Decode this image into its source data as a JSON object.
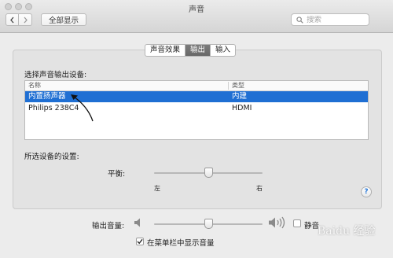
{
  "window": {
    "title": "声音"
  },
  "toolbar": {
    "back_icon": "chevron-left-icon",
    "forward_icon": "chevron-right-icon",
    "show_all_label": "全部显示",
    "search_placeholder": "搜索",
    "search_icon": "search-icon"
  },
  "tabs": [
    {
      "label": "声音效果",
      "active": false
    },
    {
      "label": "输出",
      "active": true
    },
    {
      "label": "输入",
      "active": false
    }
  ],
  "output": {
    "section_title": "选择声音输出设备:",
    "table": {
      "columns": [
        "名称",
        "类型"
      ],
      "rows": [
        {
          "name": "内置扬声器",
          "type": "内建",
          "selected": true
        },
        {
          "name": "Philips 238C4",
          "type": "HDMI",
          "selected": false
        }
      ]
    },
    "settings_title": "所选设备的设置:",
    "balance": {
      "label": "平衡:",
      "left_label": "左",
      "right_label": "右",
      "value": 0.5
    }
  },
  "volume": {
    "label": "输出音量:",
    "value": 0.5,
    "mute_label": "静音",
    "mute_checked": false,
    "show_in_menubar_label": "在菜单栏中显示音量",
    "show_in_menubar_checked": true
  },
  "watermark": {
    "text": "Baidu 经验"
  },
  "colors": {
    "selection": "#1f6fd3",
    "help_accent": "#2a7ad8"
  }
}
